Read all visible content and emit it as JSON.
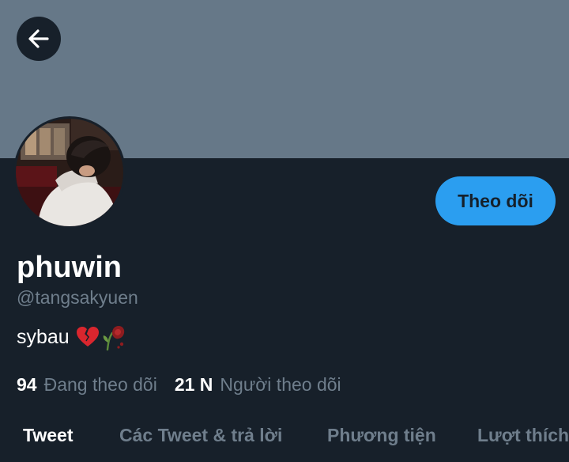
{
  "header": {
    "banner_color": "#667888",
    "back_icon": "arrow-left-icon"
  },
  "profile": {
    "avatar_icon": "profile-photo",
    "display_name": "phuwin",
    "handle": "@tangsakyuen",
    "bio_text": "sybau",
    "bio_emoji": [
      "broken-heart-emoji",
      "wilted-rose-emoji"
    ],
    "follow_label": "Theo dõi",
    "accent_color": "#2b9ef0"
  },
  "stats": {
    "following_count": "94",
    "following_label": "Đang theo dõi",
    "followers_count": "21 N",
    "followers_label": "Người theo dõi"
  },
  "tabs": [
    {
      "label": "Tweet",
      "active": true
    },
    {
      "label": "Các Tweet & trả lời",
      "active": false
    },
    {
      "label": "Phương tiện",
      "active": false
    },
    {
      "label": "Lượt thích",
      "active": false
    }
  ]
}
